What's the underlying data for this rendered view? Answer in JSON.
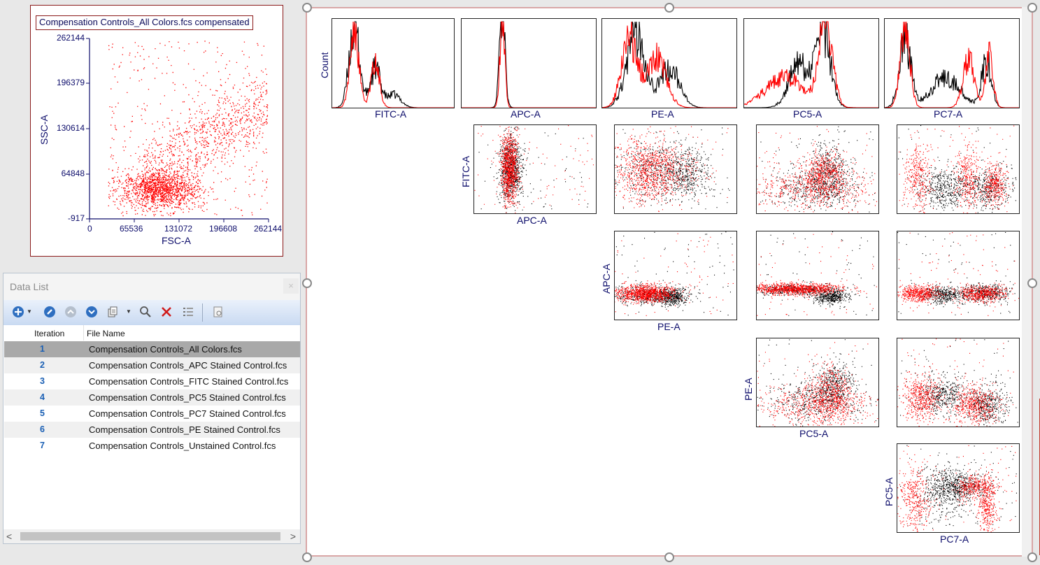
{
  "scatter": {
    "title": "Compensation Controls_All Colors.fcs compensated",
    "xlabel": "FSC-A",
    "ylabel": "SSC-A",
    "x_ticks": [
      "0",
      "65536",
      "131072",
      "196608",
      "262144"
    ],
    "y_ticks": [
      "262144",
      "196379",
      "130614",
      "64848",
      "-917"
    ],
    "point_color": "#ff0000"
  },
  "data_list": {
    "title": "Data List",
    "close_glyph": "×",
    "toolbar_icons": [
      "add-icon",
      "settings-icon",
      "move-up-icon",
      "move-down-icon",
      "copy-icon",
      "search-icon",
      "delete-icon",
      "list-options-icon",
      "properties-icon"
    ],
    "columns": [
      "Iteration",
      "File Name"
    ],
    "rows": [
      {
        "iteration": "1",
        "file": "Compensation Controls_All Colors.fcs"
      },
      {
        "iteration": "2",
        "file": "Compensation Controls_APC Stained Control.fcs"
      },
      {
        "iteration": "3",
        "file": "Compensation Controls_FITC Stained Control.fcs"
      },
      {
        "iteration": "4",
        "file": "Compensation Controls_PC5 Stained Control.fcs"
      },
      {
        "iteration": "5",
        "file": "Compensation Controls_PC7 Stained Control.fcs"
      },
      {
        "iteration": "6",
        "file": "Compensation Controls_PE Stained Control.fcs"
      },
      {
        "iteration": "7",
        "file": "Compensation Controls_Unstained Control.fcs"
      }
    ],
    "selected_row": 0,
    "scroll_left": "<",
    "scroll_right": ">"
  },
  "matrix": {
    "histogram_ylabel": "Count",
    "histograms": [
      "FITC-A",
      "APC-A",
      "PE-A",
      "PC5-A",
      "PC7-A"
    ],
    "scatter_x_labels": [
      "APC-A",
      "PE-A",
      "PC5-A",
      "PC7-A"
    ],
    "scatter_y_labels": [
      "FITC-A",
      "APC-A",
      "PE-A",
      "PC5-A"
    ],
    "series_colors": {
      "compensated": "#ff0000",
      "uncompensated": "#000000"
    }
  }
}
